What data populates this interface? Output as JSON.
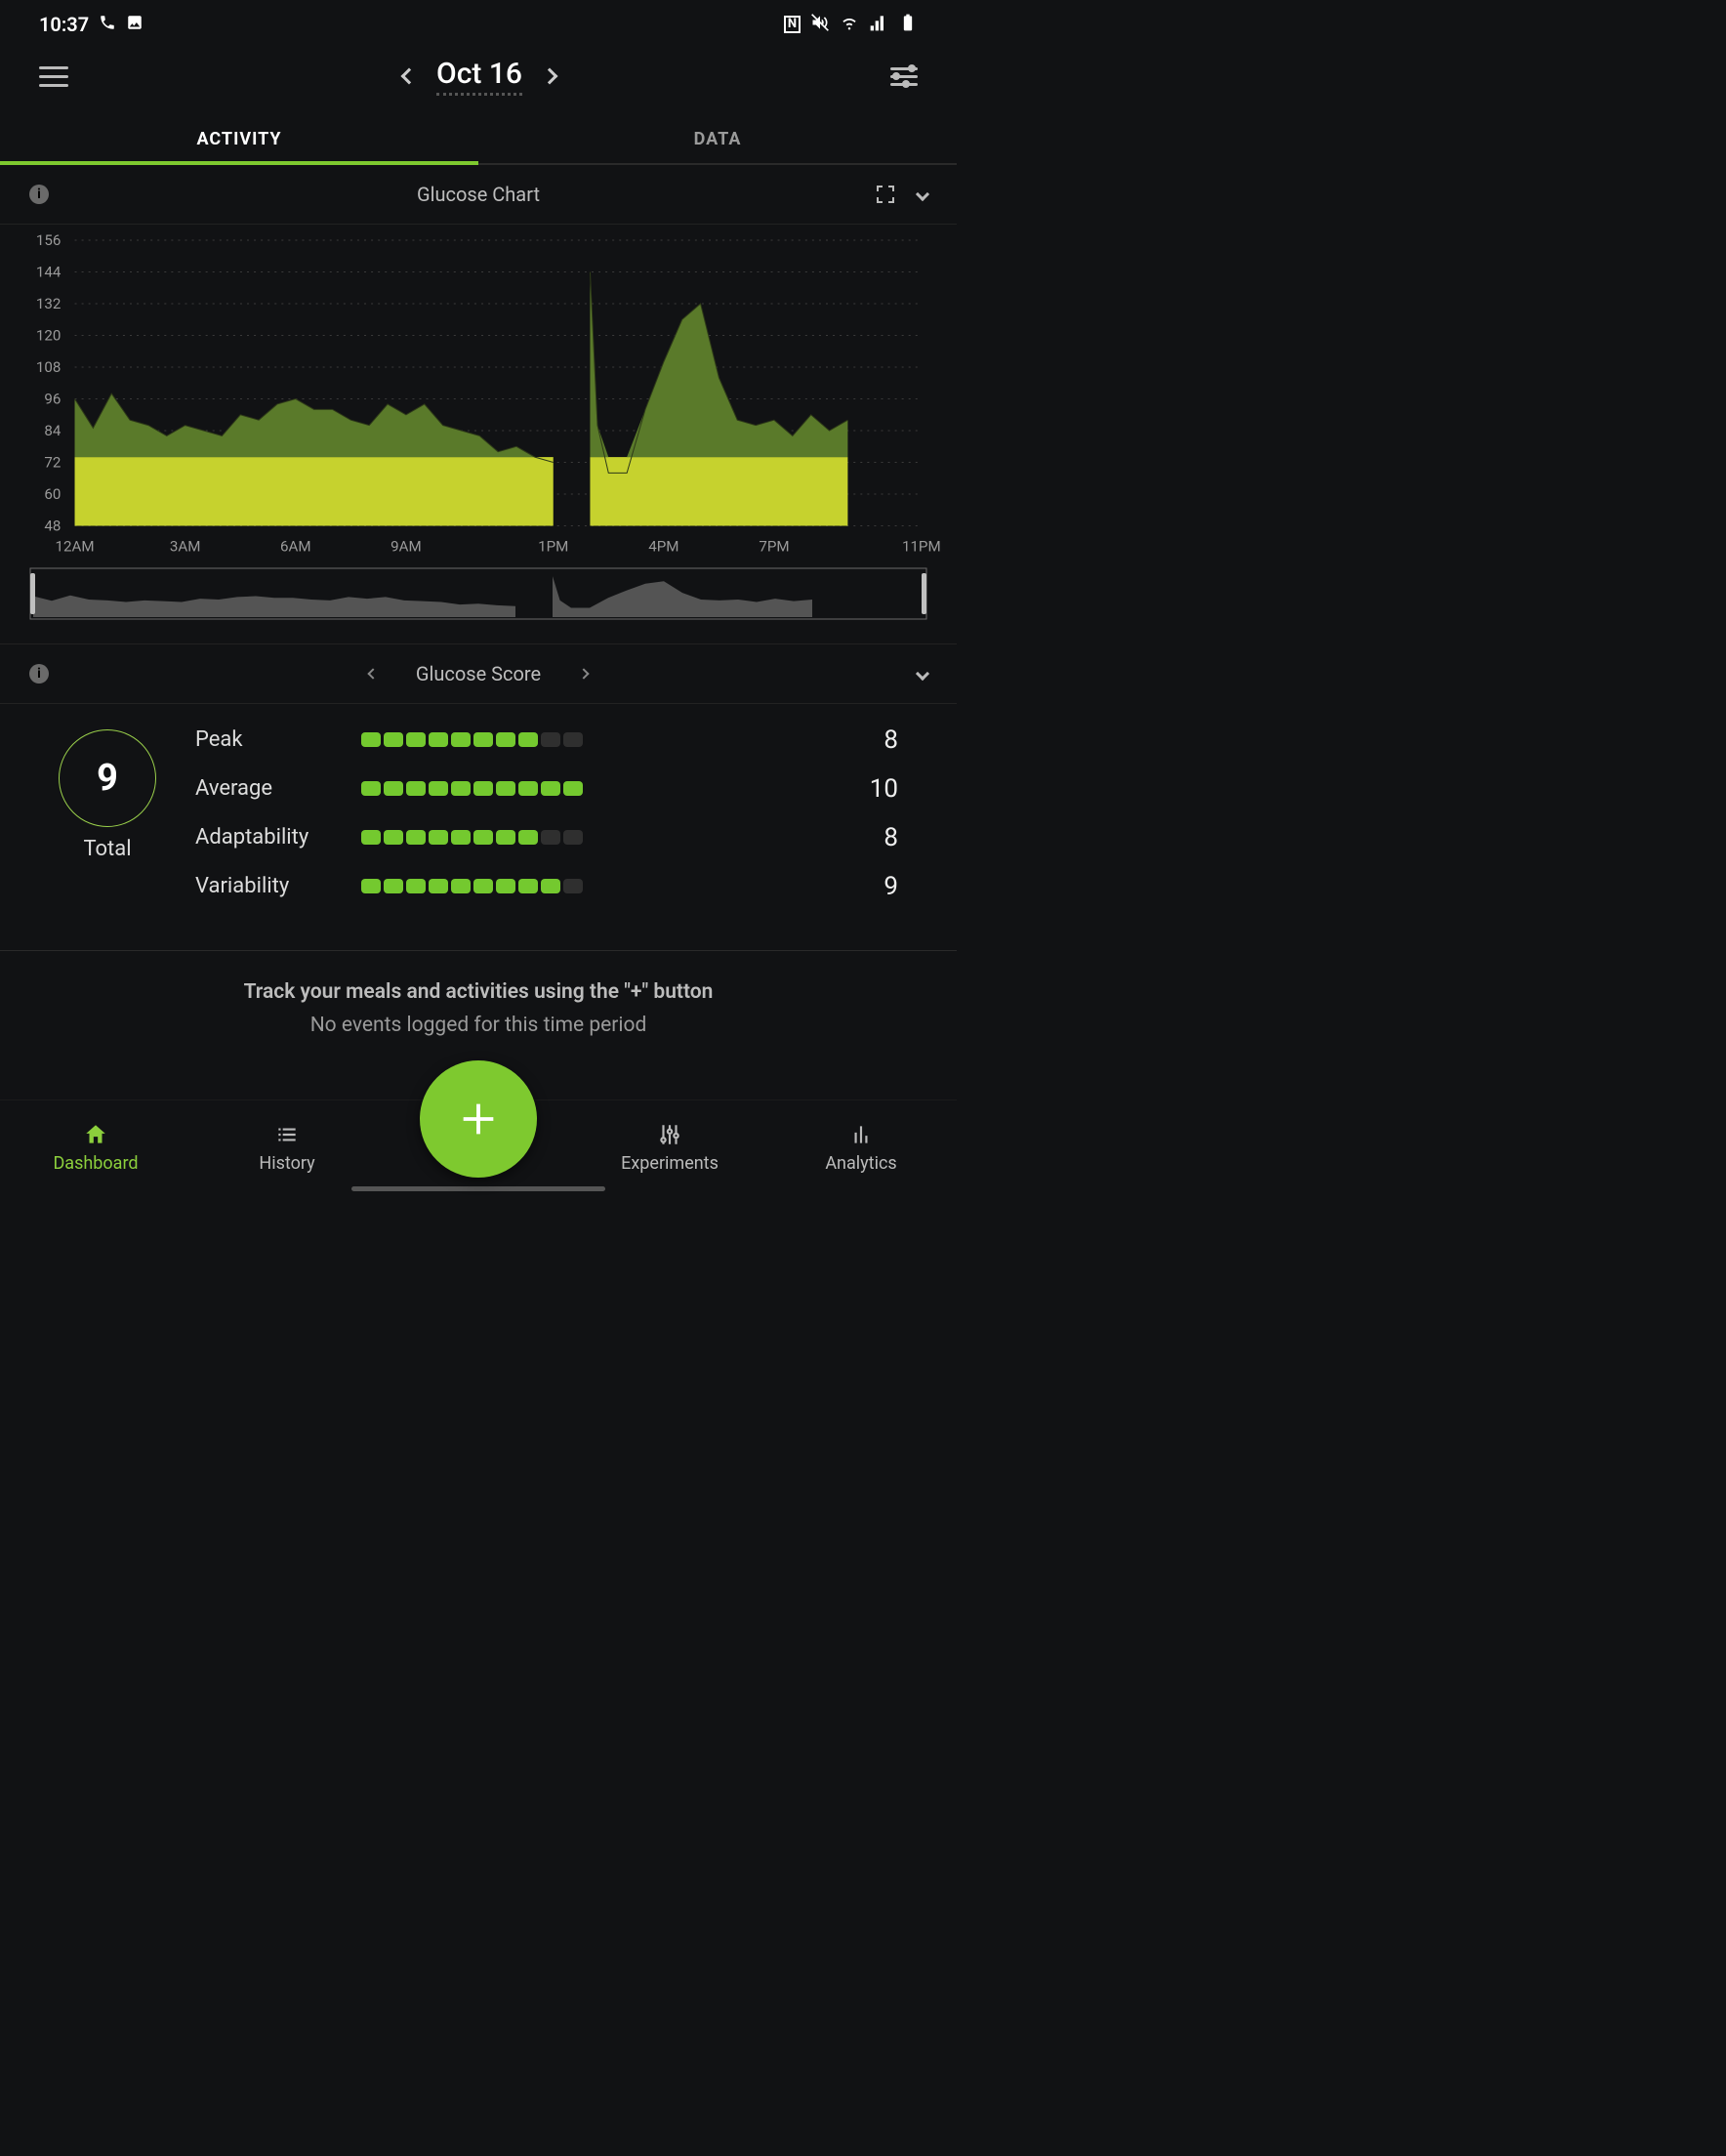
{
  "status_bar": {
    "time": "10:37"
  },
  "header": {
    "date": "Oct 16"
  },
  "tabs": {
    "activity": "ACTIVITY",
    "data": "DATA",
    "active": "activity"
  },
  "glucose_chart": {
    "title": "Glucose Chart"
  },
  "glucose_score": {
    "title": "Glucose Score",
    "total_label": "Total",
    "total": "9",
    "rows": [
      {
        "label": "Peak",
        "value": "8",
        "filled": 8
      },
      {
        "label": "Average",
        "value": "10",
        "filled": 10
      },
      {
        "label": "Adaptability",
        "value": "8",
        "filled": 8
      },
      {
        "label": "Variability",
        "value": "9",
        "filled": 9
      }
    ]
  },
  "empty_state": {
    "line1": "Track your meals and activities using the \"+\" button",
    "line2": "No events logged for this time period"
  },
  "bottom_nav": {
    "dashboard": "Dashboard",
    "history": "History",
    "experiments": "Experiments",
    "analytics": "Analytics"
  },
  "colors": {
    "accent": "#7ec92f",
    "area_dark": "#5a7a2a",
    "area_light": "#c6d22e"
  },
  "chart_data": {
    "type": "area",
    "title": "Glucose Chart",
    "xlabel": "",
    "ylabel": "",
    "ylim": [
      48,
      156
    ],
    "ytick": [
      48,
      60,
      72,
      84,
      96,
      108,
      120,
      132,
      144,
      156
    ],
    "x_labels": [
      "12AM",
      "3AM",
      "6AM",
      "9AM",
      "1PM",
      "4PM",
      "7PM",
      "11PM"
    ],
    "x_label_positions": [
      0,
      3,
      6,
      9,
      13,
      16,
      19,
      23
    ],
    "target_band": [
      48,
      74
    ],
    "series": [
      {
        "name": "glucose",
        "x": [
          0,
          0.5,
          1,
          1.5,
          2,
          2.5,
          3,
          3.5,
          4,
          4.5,
          5,
          5.5,
          6,
          6.5,
          7,
          7.5,
          8,
          8.5,
          9,
          9.5,
          10,
          10.5,
          11,
          11.5,
          12,
          12.5,
          13,
          14,
          14.2,
          14.5,
          15,
          15.5,
          16,
          16.5,
          17,
          17.5,
          18,
          18.5,
          19,
          19.5,
          20,
          20.5,
          21
        ],
        "y": [
          96,
          85,
          98,
          88,
          86,
          82,
          86,
          84,
          82,
          90,
          88,
          94,
          96,
          92,
          92,
          88,
          86,
          94,
          90,
          94,
          86,
          84,
          82,
          76,
          78,
          74,
          72,
          144,
          86,
          68,
          68,
          92,
          110,
          126,
          132,
          104,
          88,
          86,
          88,
          82,
          90,
          84,
          88
        ]
      }
    ],
    "gap": [
      13,
      14
    ]
  }
}
